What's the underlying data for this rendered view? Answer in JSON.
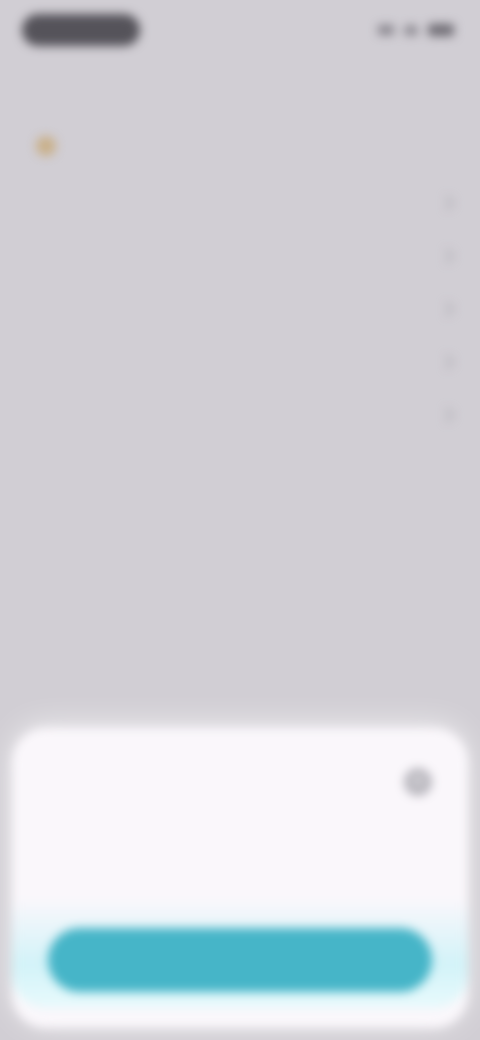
{
  "status_bar": {
    "icons": [
      "signal-icon",
      "wifi-icon",
      "battery-icon"
    ]
  },
  "nav": {
    "back_label": ""
  },
  "page": {
    "title": "",
    "title_icon": "emoji-icon"
  },
  "menu": {
    "items": [
      {
        "label": "",
        "value": ""
      },
      {
        "label": "",
        "value": ""
      },
      {
        "label": "",
        "value": ""
      },
      {
        "label": "",
        "value": ""
      },
      {
        "label": "",
        "value": ""
      }
    ]
  },
  "sheet": {
    "title": "",
    "body": "",
    "close_icon": "close-icon",
    "button_label": ""
  },
  "colors": {
    "background": "#d1ced4",
    "sheet": "#faf7fb",
    "accent": "#46b5c8"
  }
}
